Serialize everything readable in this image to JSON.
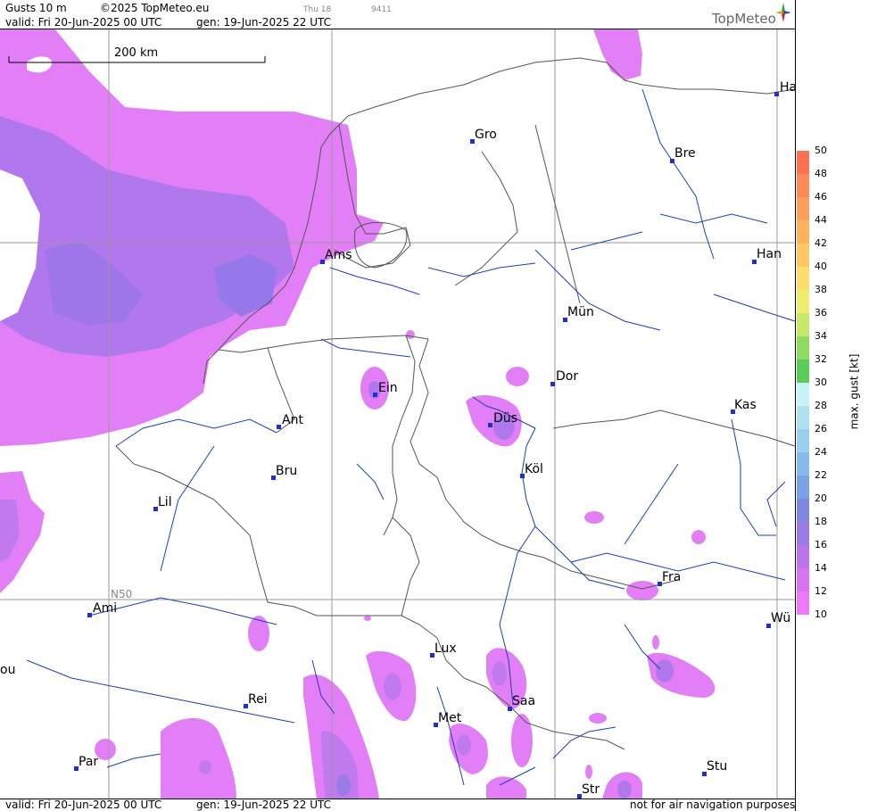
{
  "header": {
    "title": "Gusts 10 m",
    "copyright": "©2025 TopMeteo.eu",
    "day_tag": "Thu 18",
    "code": "9411",
    "valid": "valid:  Fri  20-Jun-2025  00 UTC",
    "gen": "gen: 19-Jun-2025 22 UTC",
    "brand": "TopMeteo"
  },
  "footer": {
    "valid": "valid:  Fri  20-Jun-2025  00 UTC",
    "gen": "gen: 19-Jun-2025 22 UTC",
    "disclaimer": "not for air navigation purposes"
  },
  "map": {
    "scale_label": "200 km",
    "lat_label": "N50",
    "cities": [
      {
        "id": "ha",
        "label": "Ha"
      },
      {
        "id": "gro",
        "label": "Gro"
      },
      {
        "id": "bre",
        "label": "Bre"
      },
      {
        "id": "ams",
        "label": "Ams"
      },
      {
        "id": "han",
        "label": "Han"
      },
      {
        "id": "mun",
        "label": "Mün"
      },
      {
        "id": "dor",
        "label": "Dor"
      },
      {
        "id": "ein",
        "label": "Ein"
      },
      {
        "id": "kas",
        "label": "Kas"
      },
      {
        "id": "dus",
        "label": "Düs"
      },
      {
        "id": "ant",
        "label": "Ant"
      },
      {
        "id": "kol",
        "label": "Köl"
      },
      {
        "id": "bru",
        "label": "Bru"
      },
      {
        "id": "lil",
        "label": "Lil"
      },
      {
        "id": "fra",
        "label": "Fra"
      },
      {
        "id": "ami",
        "label": "Ami"
      },
      {
        "id": "wu",
        "label": "Wü"
      },
      {
        "id": "lux",
        "label": "Lux"
      },
      {
        "id": "ou",
        "label": "ou"
      },
      {
        "id": "rei",
        "label": "Rei"
      },
      {
        "id": "saa",
        "label": "Saa"
      },
      {
        "id": "met",
        "label": "Met"
      },
      {
        "id": "par",
        "label": "Par"
      },
      {
        "id": "stu",
        "label": "Stu"
      },
      {
        "id": "str",
        "label": "Str"
      }
    ]
  },
  "colorbar": {
    "title": "max. gust [kt]",
    "ticks": [
      "50",
      "48",
      "46",
      "44",
      "42",
      "40",
      "38",
      "36",
      "34",
      "32",
      "30",
      "28",
      "26",
      "24",
      "22",
      "20",
      "18",
      "16",
      "14",
      "12",
      "10"
    ],
    "colors": [
      "#ff7050",
      "#ff8a55",
      "#ff9f5a",
      "#ffb35e",
      "#ffc764",
      "#ffdd6a",
      "#f0ec70",
      "#c8e86a",
      "#90dc60",
      "#5ccc58",
      "#c8f2f8",
      "#aee2f2",
      "#9ad0ee",
      "#86baea",
      "#7aa2e6",
      "#7e88e4",
      "#9a7ae6",
      "#bb74ea",
      "#d872f2",
      "#ee78fa"
    ]
  }
}
